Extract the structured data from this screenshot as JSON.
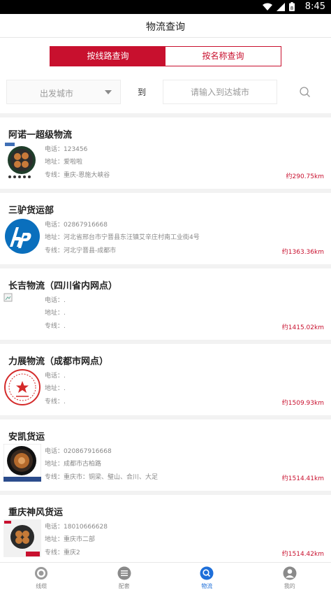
{
  "status": {
    "time": "8:45",
    "battery": "8"
  },
  "header": {
    "title": "物流查询"
  },
  "search": {
    "tab_route": "按线路查询",
    "tab_name": "按名称查询",
    "from_city": "出发城市",
    "to_label": "到",
    "to_placeholder": "请输入到达城市"
  },
  "companies": [
    {
      "name": "阿诺一超级物流",
      "phone": "电话：123456",
      "address": "地址：爱啦啦",
      "route": "专线：重庆-恩施大峡谷",
      "distance": "约290.75km"
    },
    {
      "name": "三驴货运部",
      "phone": "电话：02867916668",
      "address": "地址：河北省邢台市宁晋县东汪镇艾辛庄村南工业街4号",
      "route": "专线：河北宁晋县-成都市",
      "distance": "约1363.36km"
    },
    {
      "name": "长吉物流（四川省内网点）",
      "phone": "电话：.",
      "address": "地址：.",
      "route": "专线：.",
      "distance": "约1415.02km"
    },
    {
      "name": "力展物流（成都市网点）",
      "phone": "电话：.",
      "address": "地址：.",
      "route": "专线：.",
      "distance": "约1509.93km"
    },
    {
      "name": "安凯货运",
      "phone": "电话：020867916668",
      "address": "地址：成都市古柏路",
      "route": "专线：重庆市：铜梁、璧山、合川、大足",
      "distance": "约1514.41km"
    },
    {
      "name": "重庆神风货运",
      "phone": "电话：18010666628",
      "address": "地址：重庆市二部",
      "route": "专线：重庆2",
      "distance": "约1514.42km"
    }
  ],
  "tabbar": {
    "items": [
      {
        "label": "线缆",
        "icon": "cable-icon"
      },
      {
        "label": "配套",
        "icon": "list-icon"
      },
      {
        "label": "物流",
        "icon": "search-icon"
      },
      {
        "label": "我的",
        "icon": "user-icon"
      }
    ]
  },
  "colors": {
    "accent": "#c8102e",
    "tab_active": "#1e6fd9"
  }
}
